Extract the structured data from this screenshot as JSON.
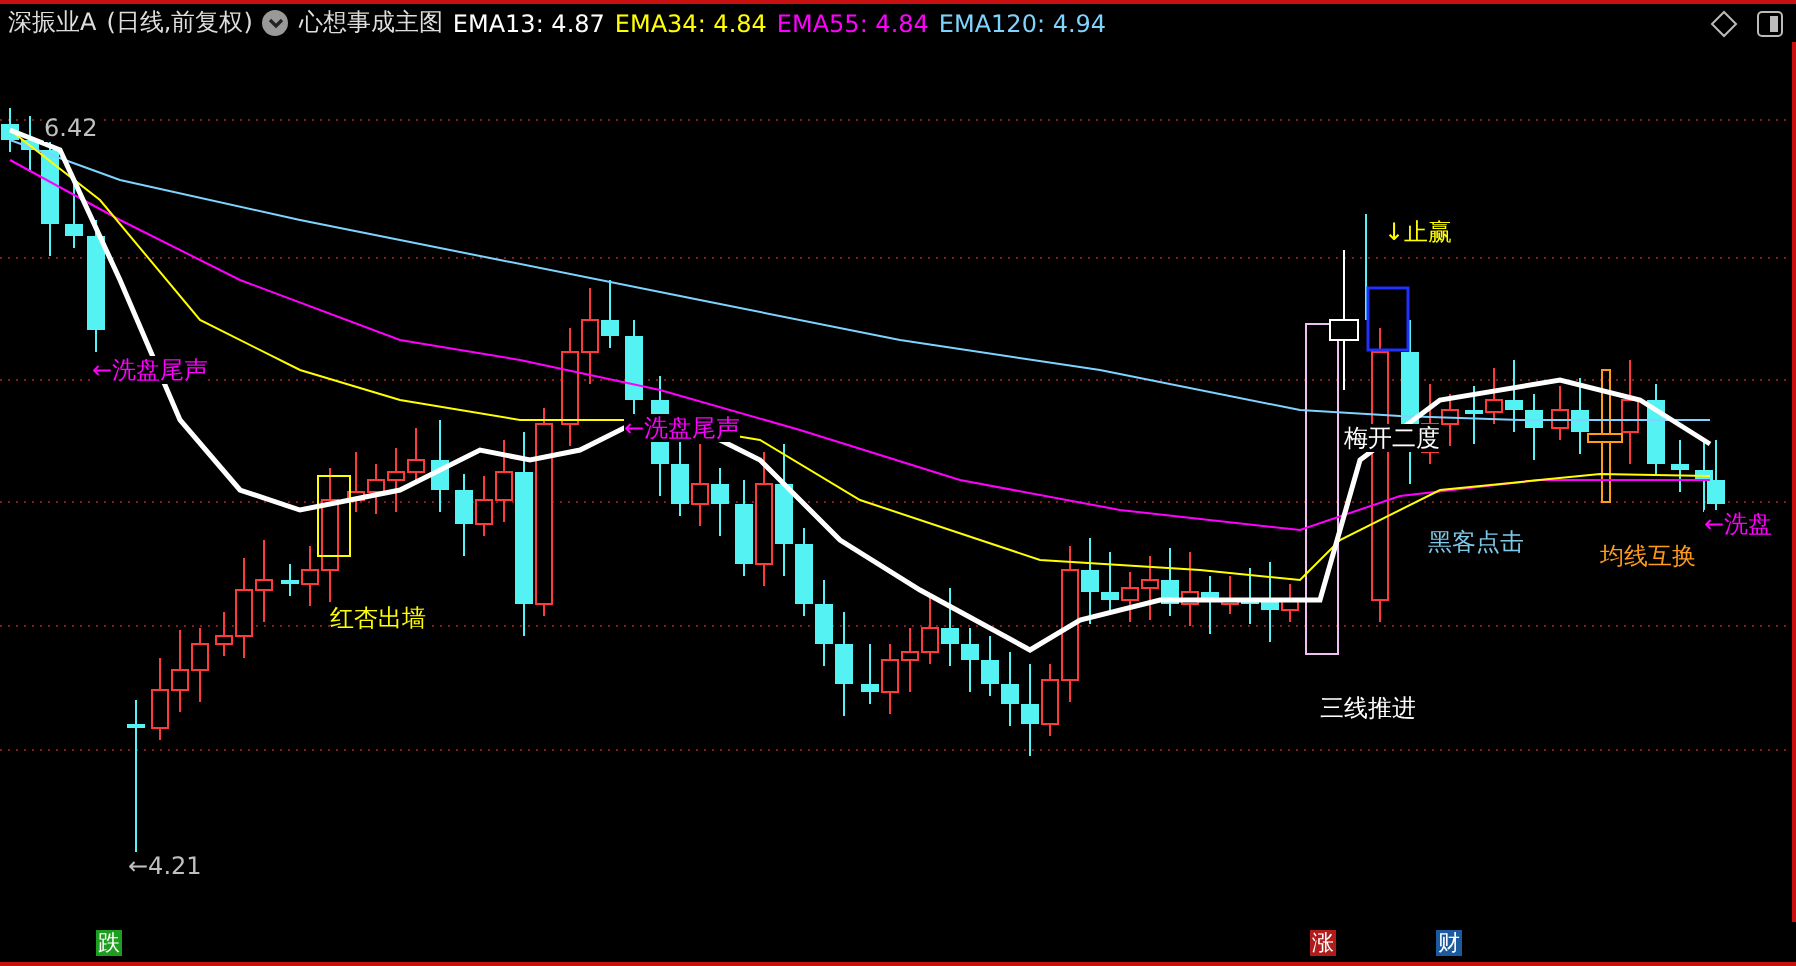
{
  "header": {
    "stock_name": "深振业A",
    "period": "(日线,前复权)",
    "indicator_name": "心想事成主图",
    "emas": [
      {
        "label": "EMA13:",
        "value": "4.87",
        "color": "#ffffff"
      },
      {
        "label": "EMA34:",
        "value": "4.84",
        "color": "#ffff00"
      },
      {
        "label": "EMA55:",
        "value": "4.84",
        "color": "#ff00ff"
      },
      {
        "label": "EMA120:",
        "value": "4.94",
        "color": "#7fd4ff"
      }
    ]
  },
  "chart": {
    "annotations": [
      {
        "text": "6.42",
        "color": "#c0c0c0"
      },
      {
        "text": "←洗盘尾声",
        "color": "#ff00ff"
      },
      {
        "text": "←洗盘尾声",
        "color": "#ff00ff"
      },
      {
        "text": "红杏出墙",
        "color": "#ffff00"
      },
      {
        "text": "↓止赢",
        "color": "#ffff00"
      },
      {
        "text": "梅开二度",
        "color": "#ffffff"
      },
      {
        "text": "黑客点击",
        "color": "#7ec8e8"
      },
      {
        "text": "均线互换",
        "color": "#ff9a1a"
      },
      {
        "text": "三线推进",
        "color": "#ffffff"
      },
      {
        "text": "←洗盘",
        "color": "#ff00ff"
      },
      {
        "text": "←4.21",
        "color": "#c0c0c0"
      }
    ]
  },
  "markers": [
    {
      "text": "跌",
      "color": "#1e9e1e"
    },
    {
      "text": "涨",
      "color": "#b01c1c"
    },
    {
      "text": "财",
      "color": "#1c5aa0"
    }
  ]
}
